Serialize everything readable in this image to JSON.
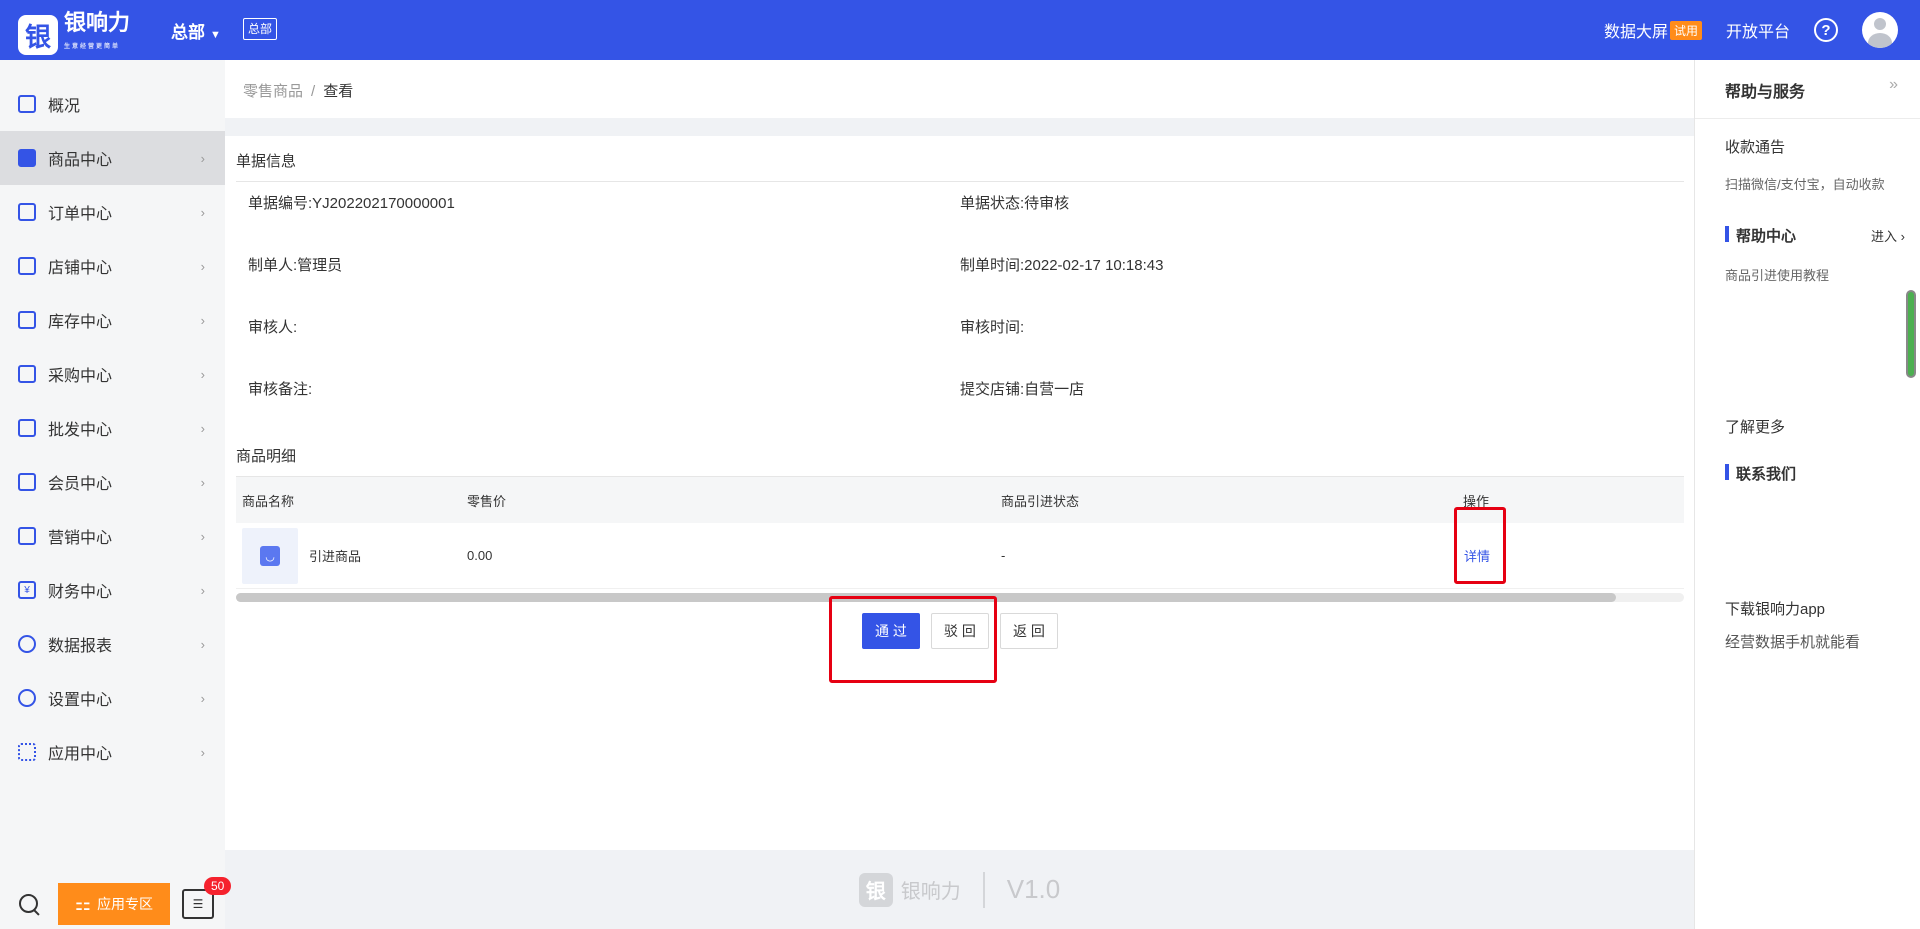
{
  "topbar": {
    "logo_mark": "银",
    "logo_text": "银响力",
    "logo_sub": "生意经营更简单",
    "org": "总部",
    "org_tag": "总部",
    "data_screen": "数据大屏",
    "trial": "试用",
    "open_platform": "开放平台",
    "help_glyph": "?"
  },
  "sidebar": {
    "items": [
      {
        "label": "概况",
        "icon": "home-icon"
      },
      {
        "label": "商品中心",
        "icon": "bag-icon"
      },
      {
        "label": "订单中心",
        "icon": "clipboard-icon"
      },
      {
        "label": "店铺中心",
        "icon": "store-icon"
      },
      {
        "label": "库存中心",
        "icon": "inventory-icon"
      },
      {
        "label": "采购中心",
        "icon": "purchase-icon"
      },
      {
        "label": "批发中心",
        "icon": "wholesale-icon"
      },
      {
        "label": "会员中心",
        "icon": "member-icon"
      },
      {
        "label": "营销中心",
        "icon": "marketing-icon"
      },
      {
        "label": "财务中心",
        "icon": "yuan-icon"
      },
      {
        "label": "数据报表",
        "icon": "chart-icon"
      },
      {
        "label": "设置中心",
        "icon": "settings-icon"
      },
      {
        "label": "应用中心",
        "icon": "apps-icon"
      }
    ],
    "app_zone": "应用专区",
    "msg_count": "50"
  },
  "breadcrumb": {
    "parent": "零售商品",
    "sep": "/",
    "current": "查看"
  },
  "doc_info": {
    "title": "单据信息",
    "doc_no": "单据编号:YJ202202170000001",
    "status": "单据状态:待审核",
    "creator": "制单人:管理员",
    "created_time": "制单时间:2022-02-17 10:18:43",
    "reviewer": "审核人:",
    "review_time": "审核时间:",
    "review_note": "审核备注:",
    "store": "提交店铺:自营一店"
  },
  "goods": {
    "title": "商品明细",
    "columns": [
      "商品名称",
      "零售价",
      "商品引进状态",
      "操作"
    ],
    "rows": [
      {
        "name": "引进商品",
        "price": "0.00",
        "status": "-",
        "action": "详情"
      }
    ]
  },
  "actions": {
    "approve": "通 过",
    "reject": "驳 回",
    "back": "返 回"
  },
  "footer": {
    "logo": "银",
    "brand": "银响力",
    "version": "V1.0"
  },
  "help_panel": {
    "title": "帮助与服务",
    "collapse": "»",
    "payment_title": "收款通告",
    "payment_desc": "扫描微信/支付宝，自动收款",
    "help_center": "帮助中心",
    "enter": "进入 ›",
    "tutorial": "商品引进使用教程",
    "learn_more": "了解更多",
    "contact": "联系我们",
    "download": "下载银响力app",
    "download_desc": "经营数据手机就能看"
  },
  "colors": {
    "brand": "#3454e6",
    "accent": "#ff8c1a",
    "highlight": "#e60012"
  }
}
